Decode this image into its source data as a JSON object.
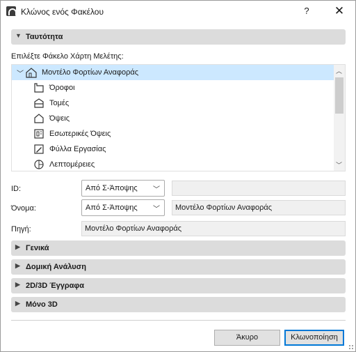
{
  "window": {
    "title": "Κλώνος ενός Φακέλου",
    "help_label": "?",
    "close_label": "✕"
  },
  "sections": {
    "identity": "Ταυτότητα",
    "general": "Γενικά",
    "structural": "Δομική Ανάλυση",
    "documents": "2D/3D Έγγραφα",
    "only3d": "Μόνο 3D"
  },
  "tree": {
    "prompt": "Επιλέξτε Φάκελο Χάρτη Μελέτης:",
    "root": {
      "label": "Μοντέλο Φορτίων Αναφοράς",
      "icon": "house-icon",
      "selected": true
    },
    "items": [
      {
        "label": "Όροφοι",
        "icon": "floor-plan-icon"
      },
      {
        "label": "Τομές",
        "icon": "section-icon"
      },
      {
        "label": "Όψεις",
        "icon": "elevation-icon"
      },
      {
        "label": "Εσωτερικές Όψεις",
        "icon": "interior-elevation-icon"
      },
      {
        "label": "Φύλλα Εργασίας",
        "icon": "worksheet-icon"
      },
      {
        "label": "Λεπτομέρειες",
        "icon": "detail-icon"
      }
    ]
  },
  "fields": {
    "id": {
      "label": "ID:",
      "select": "Από Σ-Άποψης",
      "value": ""
    },
    "name": {
      "label": "Όνομα:",
      "select": "Από Σ-Άποψης",
      "value": "Μοντέλο Φορτίων Αναφοράς"
    },
    "source": {
      "label": "Πηγή:",
      "value": "Μοντέλο Φορτίων Αναφοράς"
    }
  },
  "buttons": {
    "cancel": "Άκυρο",
    "clone": "Κλωνοποίηση"
  }
}
